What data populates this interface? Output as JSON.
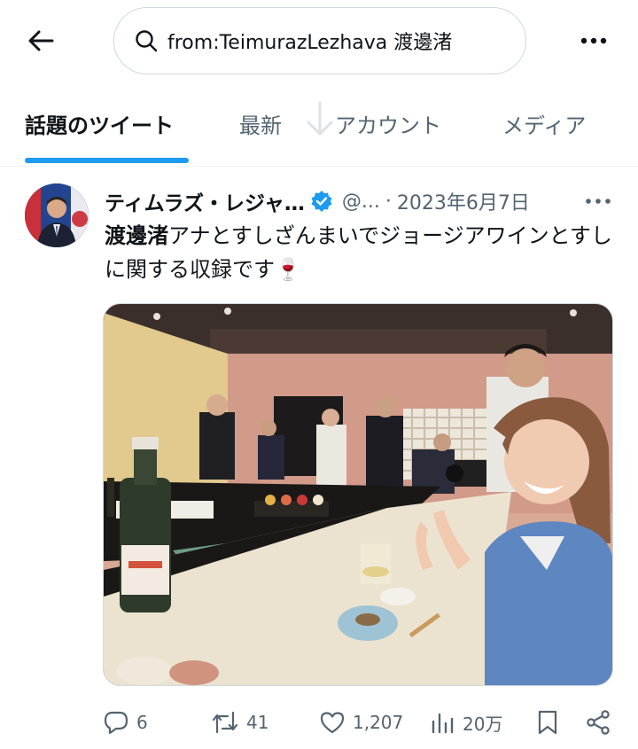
{
  "search": {
    "query": "from:TeimurazLezhava 渡邊渚"
  },
  "tabs": [
    {
      "label": "話題のツイート",
      "active": true
    },
    {
      "label": "最新",
      "active": false
    },
    {
      "label": "アカウント",
      "active": false
    },
    {
      "label": "メディア",
      "active": false
    }
  ],
  "tweet": {
    "display_name": "ティムラズ・レジャ…",
    "handle": "@...",
    "separator": "·",
    "date": "2023年6月7日",
    "text_highlight": "渡邊渚",
    "text_rest": "アナとすしざんまいでジョージアワインとすしに関する収録です",
    "emoji": "🍷",
    "actions": {
      "replies": "6",
      "retweets": "41",
      "likes": "1,207",
      "views": "20万"
    }
  },
  "colors": {
    "accent": "#1d9bf0",
    "text_primary": "#0f1419",
    "text_secondary": "#536471",
    "border": "#cfd9de"
  },
  "icons": [
    "back-arrow-icon",
    "search-icon",
    "more-icon",
    "verified-icon",
    "reply-icon",
    "retweet-icon",
    "like-icon",
    "views-icon",
    "bookmark-icon",
    "share-icon"
  ]
}
